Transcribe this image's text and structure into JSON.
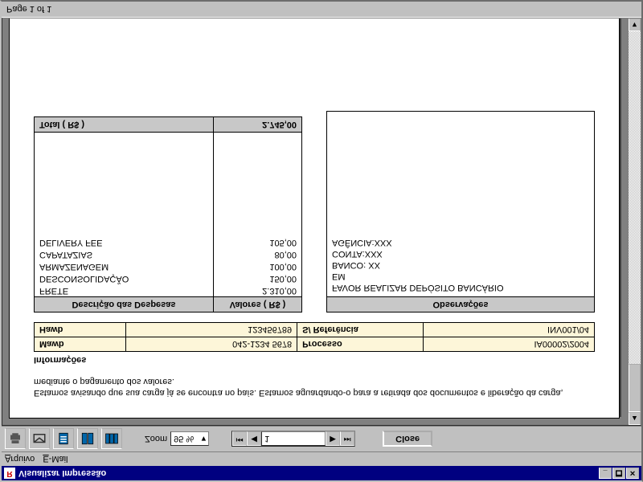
{
  "window": {
    "icon_letter": "R",
    "title": "Visualizar Impressão"
  },
  "controls": {
    "minimize": "_",
    "maximize": "🗖",
    "close": "✕"
  },
  "menu": {
    "arquivo": "Arquivo",
    "arquivo_u": "A",
    "email": "E-Mail",
    "email_u": "E"
  },
  "toolbar": {
    "zoom_label": "Zoom",
    "zoom_value": "95 %",
    "nav_value": "1",
    "close_label": "Close"
  },
  "doc": {
    "body": "Estamos avisando que sua carga já se encontra no país. Estamos aguardando-o para a retirada dos documentos e liberação da carga, mediante o pagamento dos valores.",
    "info_title": "Informações",
    "info": {
      "mawb_lbl": "Mawb",
      "mawb_val": "042-1234 5678",
      "proc_lbl": "Processo",
      "proc_val": "IA00002/2004",
      "hawb_lbl": "Hawb",
      "hawb_val": "123456789",
      "ref_lbl": "S/ Referência",
      "ref_val": "INV001/04"
    },
    "expenses": {
      "h1": "Descrição das Despesas",
      "h2": "Valores ( R$ )",
      "rows": [
        {
          "d": "FRETE",
          "v": "2.310,00"
        },
        {
          "d": "DESCONSOLIDAÇÃO",
          "v": "150,00"
        },
        {
          "d": "ARMAZENAGEM",
          "v": "100,00"
        },
        {
          "d": "CAPATAZIAS",
          "v": "80,00"
        },
        {
          "d": "DELIVERY FEE",
          "v": "105,00"
        }
      ],
      "total_lbl": "Total ( R$ )",
      "total_val": "2.745,00"
    },
    "obs": {
      "header": "Observações",
      "lines": [
        "FAVOR REALIZAR DEPÓSITO BANCÁRIO",
        "EM",
        "BANCO: XX",
        "CONTA:XXX",
        "AGÊNCIA:XXX"
      ]
    }
  },
  "status": {
    "page": "Page 1 of 1"
  }
}
